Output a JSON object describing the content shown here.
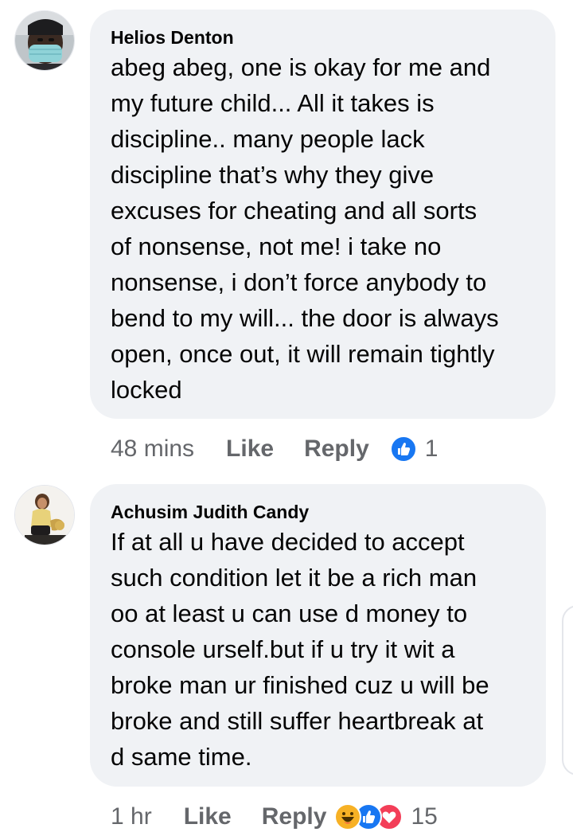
{
  "comments": [
    {
      "author": "Helios Denton",
      "lines": [
        "abeg abeg, one is okay for me and",
        "my future child...  All it takes is",
        "discipline.. many people lack",
        "discipline that’s why they give",
        "excuses for cheating and all sorts",
        "of nonsense, not me! i take no",
        "nonsense, i don’t force anybody to",
        "bend to my will... the door is always",
        "open, once out, it will remain tightly",
        "locked"
      ],
      "time": "48 mins",
      "like_label": "Like",
      "reply_label": "Reply",
      "reaction_icons": [
        "like-icon"
      ],
      "reaction_count": "1"
    },
    {
      "author": "Achusim Judith Candy",
      "lines": [
        "If at all u have decided to accept",
        "such condition let it be a rich man",
        "oo at least u can use d money to",
        "console urself.but if u try it wit a",
        "broke man ur finished cuz u will be",
        "broke and still suffer heartbreak at",
        "d same time."
      ],
      "time": "1 hr",
      "like_label": "Like",
      "reply_label": "Reply",
      "reaction_icons": [
        "haha-icon",
        "like-icon",
        "love-icon"
      ],
      "reaction_count": "15"
    }
  ],
  "colors": {
    "bubble": "#f0f2f5",
    "text": "#050505",
    "meta": "#65676b",
    "like_blue": "#1877f2",
    "love_red": "#f33e58",
    "haha_yellow": "#f7b125"
  }
}
